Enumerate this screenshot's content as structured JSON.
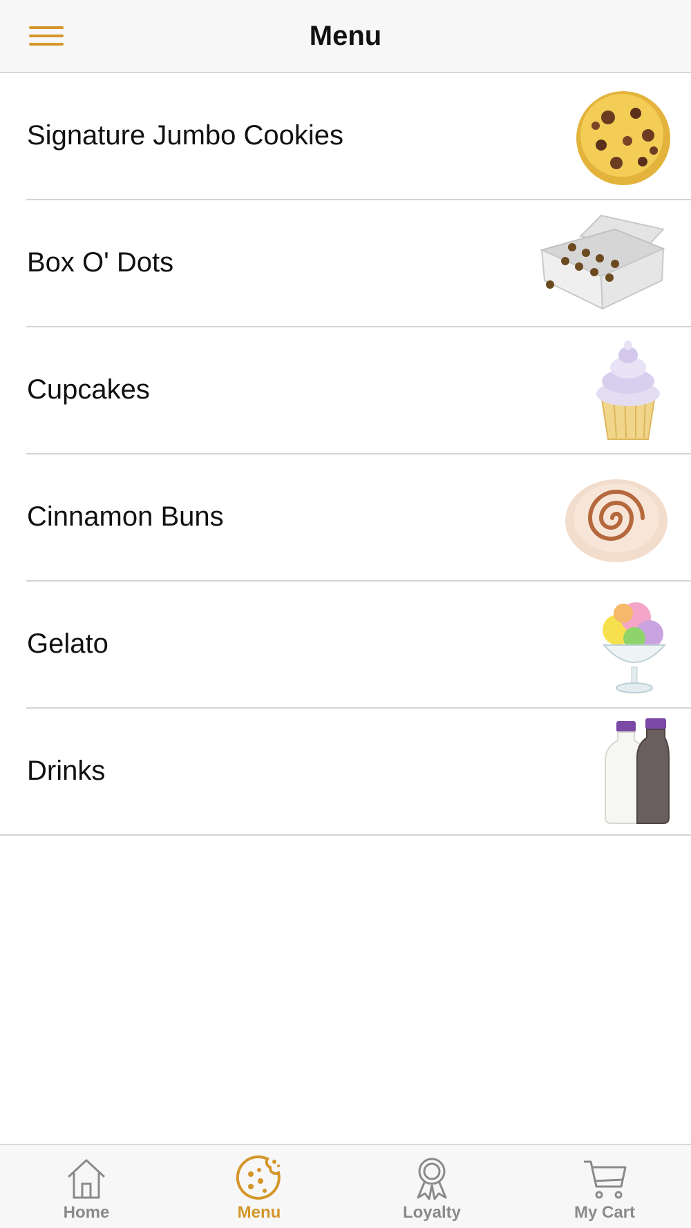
{
  "header": {
    "title": "Menu",
    "menu_icon": "hamburger-icon"
  },
  "colors": {
    "accent": "#d4962a",
    "inactive": "#8a8a8a",
    "divider": "#d3d3d3",
    "header_bg": "#f7f7f7"
  },
  "menu": {
    "items": [
      {
        "label": "Signature Jumbo Cookies",
        "image": "jumbo-cookie-image"
      },
      {
        "label": "Box O' Dots",
        "image": "box-of-dots-image"
      },
      {
        "label": "Cupcakes",
        "image": "cupcake-image"
      },
      {
        "label": "Cinnamon Buns",
        "image": "cinnamon-bun-image"
      },
      {
        "label": "Gelato",
        "image": "gelato-image"
      },
      {
        "label": "Drinks",
        "image": "milk-bottles-image"
      }
    ]
  },
  "tabbar": {
    "tabs": [
      {
        "label": "Home",
        "icon": "home-icon",
        "active": false
      },
      {
        "label": "Menu",
        "icon": "cookie-icon",
        "active": true
      },
      {
        "label": "Loyalty",
        "icon": "award-ribbon-icon",
        "active": false
      },
      {
        "label": "My Cart",
        "icon": "cart-icon",
        "active": false
      }
    ]
  }
}
